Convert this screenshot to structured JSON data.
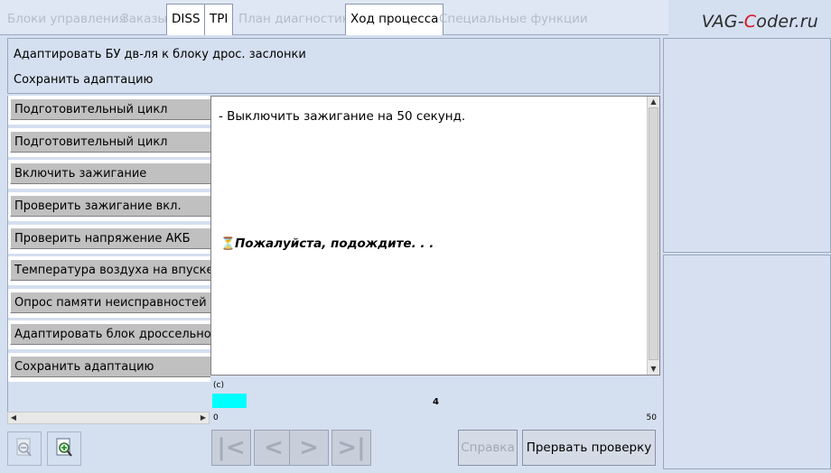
{
  "tabs": [
    {
      "label": "Блоки управления",
      "active": false
    },
    {
      "label": "Заказы",
      "active": false
    },
    {
      "label": "DISS",
      "active": true
    },
    {
      "label": "TPI",
      "active": true
    },
    {
      "label": "План диагностики",
      "active": false
    },
    {
      "label": "Ход процесса",
      "active": true
    },
    {
      "label": "Специальные функции",
      "active": false
    }
  ],
  "brand": {
    "prefix": "VAG-",
    "highlight": "C",
    "suffix": "oder.ru"
  },
  "header": {
    "title": "Адаптировать БУ дв-ля к блоку дрос. заслонки",
    "subtitle": "Сохранить адаптацию"
  },
  "steps": [
    "Подготовительный цикл",
    "Подготовительный цикл",
    "Включить зажигание",
    "Проверить зажигание вкл.",
    "Проверить напряжение АКБ",
    "Температура воздуха на впуске",
    "Опрос памяти неисправностей",
    "Адаптировать блок дроссельной заслонки",
    "Сохранить адаптацию"
  ],
  "content": {
    "instruction": "- Выключить зажигание на 50 секунд.",
    "wait_message": "Пожалуйста, подождите. . ."
  },
  "progress": {
    "unit": "(с)",
    "value": "4",
    "min": "0",
    "max": "50",
    "fraction": 0.08
  },
  "buttons": {
    "help": "Справка",
    "abort": "Прервать проверку"
  },
  "colors": {
    "brand_accent": "#d8131d",
    "progress_fill": "#00ffff"
  }
}
